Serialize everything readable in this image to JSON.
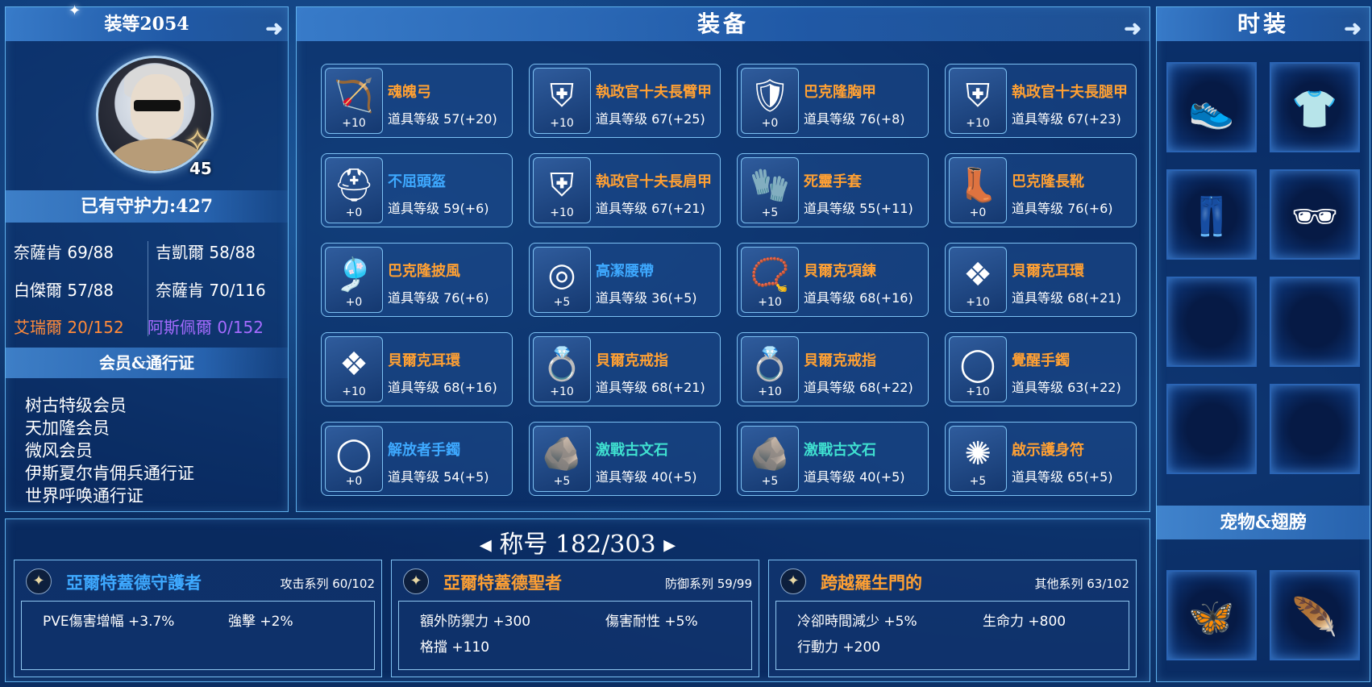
{
  "left": {
    "gear_score": "装等2054",
    "level": "45",
    "guard": "已有守护力:427",
    "stats": [
      {
        "text": "奈薩肯 69/88",
        "color": "#ffffff"
      },
      {
        "text": "吉凱爾 58/88",
        "color": "#ffffff"
      },
      {
        "text": "白傑爾 57/88",
        "color": "#ffffff"
      },
      {
        "text": "奈薩肯 70/116",
        "color": "#ffffff"
      },
      {
        "text": "艾瑞爾 20/152",
        "color": "#ff8a3a"
      },
      {
        "text": "阿斯佩爾 0/152",
        "color": "#a56bff"
      }
    ],
    "membership_title": "会员&通行证",
    "memberships": [
      "树古特级会员",
      "天加隆会员",
      "微风会员",
      "伊斯夏尔肯佣兵通行证",
      "世界呼唤通行证"
    ]
  },
  "equipment": {
    "title": "装备",
    "items": [
      {
        "name": "魂魄弓",
        "level": "道具等级 57(+20)",
        "enh": "+10",
        "color": "orange",
        "icon": "bow-icon"
      },
      {
        "name": "執政官十夫長臂甲",
        "level": "道具等级 67(+25)",
        "enh": "+10",
        "color": "orange",
        "icon": "arm-armor-icon"
      },
      {
        "name": "巴克隆胸甲",
        "level": "道具等级 76(+8)",
        "enh": "+0",
        "color": "orange",
        "icon": "chest-armor-icon"
      },
      {
        "name": "執政官十夫長腿甲",
        "level": "道具等级 67(+23)",
        "enh": "+10",
        "color": "orange",
        "icon": "leg-armor-icon"
      },
      {
        "name": "不屈頭盔",
        "level": "道具等级 59(+6)",
        "enh": "+0",
        "color": "blue",
        "icon": "helmet-icon"
      },
      {
        "name": "執政官十夫長肩甲",
        "level": "道具等级 67(+21)",
        "enh": "+10",
        "color": "orange",
        "icon": "shoulder-armor-icon"
      },
      {
        "name": "死靈手套",
        "level": "道具等级 55(+11)",
        "enh": "+5",
        "color": "orange",
        "icon": "gloves-icon"
      },
      {
        "name": "巴克隆長靴",
        "level": "道具等级 76(+6)",
        "enh": "+0",
        "color": "orange",
        "icon": "boots-icon"
      },
      {
        "name": "巴克隆披風",
        "level": "道具等级 76(+6)",
        "enh": "+0",
        "color": "orange",
        "icon": "cape-icon"
      },
      {
        "name": "高潔腰帶",
        "level": "道具等级 36(+5)",
        "enh": "+5",
        "color": "blue",
        "icon": "belt-icon"
      },
      {
        "name": "貝爾克項鍊",
        "level": "道具等级 68(+16)",
        "enh": "+10",
        "color": "orange",
        "icon": "necklace-icon"
      },
      {
        "name": "貝爾克耳環",
        "level": "道具等级 68(+21)",
        "enh": "+10",
        "color": "orange",
        "icon": "earring-icon"
      },
      {
        "name": "貝爾克耳環",
        "level": "道具等级 68(+16)",
        "enh": "+10",
        "color": "orange",
        "icon": "earring-icon"
      },
      {
        "name": "貝爾克戒指",
        "level": "道具等级 68(+21)",
        "enh": "+10",
        "color": "orange",
        "icon": "ring-icon"
      },
      {
        "name": "貝爾克戒指",
        "level": "道具等级 68(+22)",
        "enh": "+10",
        "color": "orange",
        "icon": "ring-icon"
      },
      {
        "name": "覺醒手鐲",
        "level": "道具等级 63(+22)",
        "enh": "+10",
        "color": "orange",
        "icon": "bracelet-icon"
      },
      {
        "name": "解放者手鐲",
        "level": "道具等级 54(+5)",
        "enh": "+0",
        "color": "blue",
        "icon": "bracelet-icon"
      },
      {
        "name": "激戰古文石",
        "level": "道具等级 40(+5)",
        "enh": "+5",
        "color": "teal",
        "icon": "rune-stone-icon"
      },
      {
        "name": "激戰古文石",
        "level": "道具等级 40(+5)",
        "enh": "+5",
        "color": "teal",
        "icon": "rune-stone-icon"
      },
      {
        "name": "啟示護身符",
        "level": "道具等级 65(+5)",
        "enh": "+5",
        "color": "orange",
        "icon": "amulet-icon"
      }
    ]
  },
  "fashion": {
    "title": "时装",
    "slots": [
      {
        "icon": "sneakers-icon"
      },
      {
        "icon": "shirt-icon"
      },
      {
        "icon": "pants-icon"
      },
      {
        "icon": "sunglasses-icon"
      },
      {
        "icon": "empty-slot"
      },
      {
        "icon": "empty-slot"
      },
      {
        "icon": "empty-slot"
      },
      {
        "icon": "empty-slot"
      }
    ],
    "pet_title": "宠物&翅膀",
    "pets": [
      {
        "icon": "butterfly-wings-icon"
      },
      {
        "icon": "dark-wings-icon"
      }
    ]
  },
  "titles": {
    "header": "称号 182/303",
    "cards": [
      {
        "name": "亞爾特蓋德守護者",
        "name_color": "#3ea9ff",
        "series": "攻击系列 60/102",
        "effects": [
          "PVE傷害增幅 +3.7%",
          "強擊 +2%"
        ]
      },
      {
        "name": "亞爾特蓋德聖者",
        "name_color": "#ffa033",
        "series": "防御系列 59/99",
        "effects": [
          "額外防禦力 +300",
          "傷害耐性 +5%",
          "格擋 +110"
        ]
      },
      {
        "name": "跨越羅生門的",
        "name_color": "#ffa033",
        "series": "其他系列 63/102",
        "effects": [
          "冷卻時間減少 +5%",
          "生命力 +800",
          "行動力 +200"
        ]
      }
    ]
  }
}
